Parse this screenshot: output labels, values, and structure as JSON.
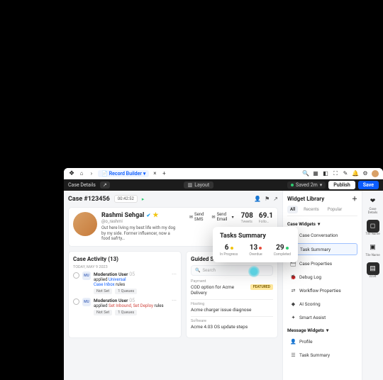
{
  "topbar": {
    "record_builder": "Record Builder"
  },
  "blackbar": {
    "case_details": "Case Details",
    "layout": "Layout",
    "saved": "Saved 2m",
    "publish": "Publish",
    "save": "Save"
  },
  "case": {
    "title": "Case #123456",
    "timer": "00:42:52"
  },
  "profile": {
    "name": "Rashmi Sehgal",
    "handle": "@o_rashmi",
    "bio": "Out here living my best life with my dog by my side. Former influencer, now a food safrty…",
    "tweets_n": "708",
    "tweets_l": "Tweets",
    "follow_n": "69.1",
    "follow_l": "Follo…",
    "send_sms": "Send SMS",
    "send_email": "Send Email"
  },
  "activity": {
    "title": "Case Activity (13)",
    "date": "TODAY, MAY 9 2023",
    "items": [
      {
        "av": "MU",
        "name": "Moderation User",
        "time": "05",
        "l1": "applied",
        "link1": "Universal",
        "l2": "Case Inbox",
        "l3": "rules"
      },
      {
        "av": "MU",
        "name": "Moderation User",
        "time": "05",
        "l1": "applied",
        "red": "Set Inbound, Set Deploy",
        "l3": "rules"
      }
    ],
    "pill1": "Not Set",
    "pill2": "1 Queues"
  },
  "scripts": {
    "title": "Guided Scripts",
    "search": "Search",
    "items": [
      {
        "cat": "Payment",
        "title": "COD option for Acme Delivery",
        "badge": "FEATURED"
      },
      {
        "cat": "Hosting",
        "title": "Acme charger issue diagnose"
      },
      {
        "cat": "Software",
        "title": "Acme 4.03 OS update steps"
      }
    ]
  },
  "sidebar": {
    "title": "Widget Library",
    "tabs": {
      "all": "All",
      "recents": "Recents",
      "popular": "Popular"
    },
    "g1": "Case Widgets",
    "items1": [
      "Case Conversation",
      "Task Summary",
      "Case Properties",
      "Debug Log",
      "Workflow Properties",
      "AI Scoring",
      "Smart Assist"
    ],
    "g2": "Message Widgets",
    "items2": [
      "Profile",
      "Task Summary"
    ]
  },
  "rail": {
    "i1": "Case Details",
    "i2": "Tile Name",
    "i3": "Tile Name",
    "i4": "2234"
  },
  "tasks": {
    "title": "Tasks Summary",
    "s": [
      {
        "n": "6",
        "l": "In Progress"
      },
      {
        "n": "13",
        "l": "Overdue"
      },
      {
        "n": "29",
        "l": "Completed"
      }
    ]
  }
}
